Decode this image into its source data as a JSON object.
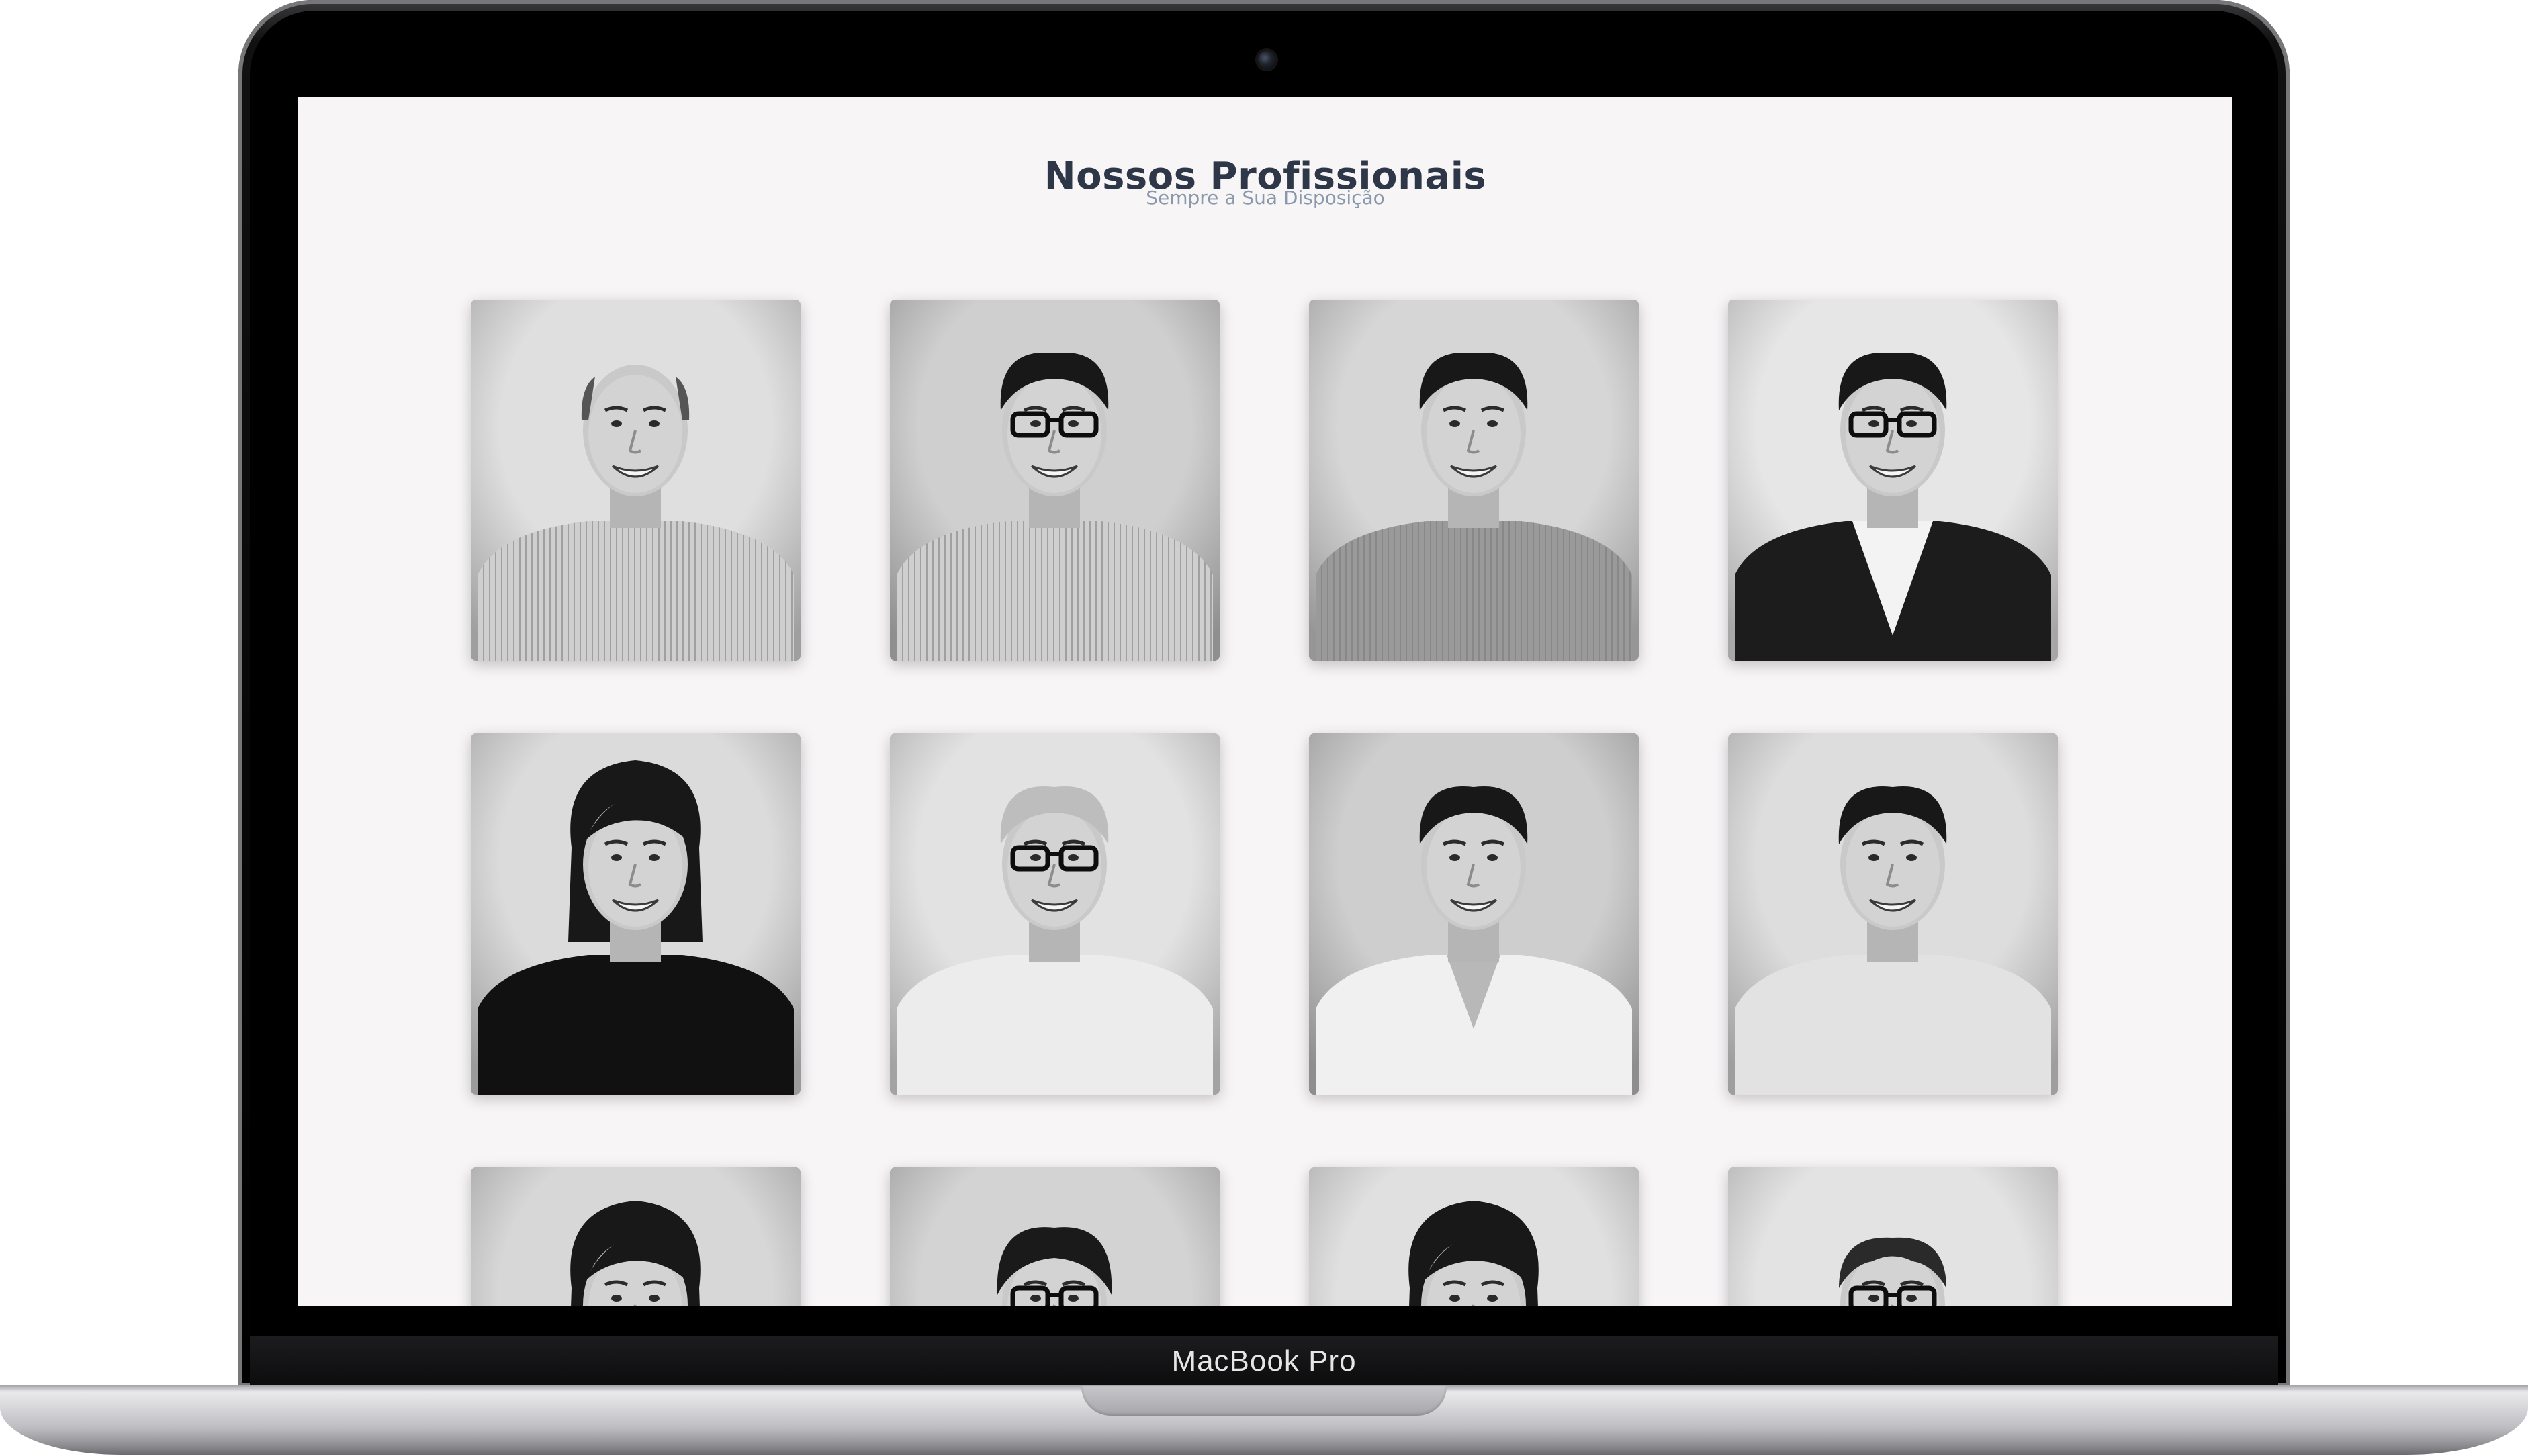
{
  "device": {
    "model_label": "MacBook Pro"
  },
  "page": {
    "title": "Nossos Profissionais",
    "subtitle": "Sempre a Sua Disposição"
  },
  "professionals": [
    {
      "portrait": "man-smiling-striped-shirt",
      "bg": "#d4d4d4",
      "top": "stripes-light",
      "hair": "bald",
      "glasses": false
    },
    {
      "portrait": "man-glasses-dark-hair",
      "bg": "#bfbfbf",
      "top": "stripes-light",
      "hair": "dark",
      "glasses": true
    },
    {
      "portrait": "man-dark-hair-striped-shirt",
      "bg": "#c8c8c8",
      "top": "stripes-dark",
      "hair": "dark",
      "glasses": false
    },
    {
      "portrait": "man-glasses-dark-suit",
      "bg": "#dedede",
      "top": "suit",
      "hair": "dark",
      "glasses": true
    },
    {
      "portrait": "woman-dark-top",
      "bg": "#cfcfcf",
      "top": "black",
      "hair": "bob",
      "glasses": false
    },
    {
      "portrait": "older-man-glasses",
      "bg": "#d9d9d9",
      "top": "white",
      "hair": "grey",
      "glasses": true
    },
    {
      "portrait": "man-lab-coat",
      "bg": "#bdbdbd",
      "top": "labcoat",
      "hair": "dark",
      "glasses": false
    },
    {
      "portrait": "man-light-shirt-arms-crossed",
      "bg": "#d2d2d2",
      "top": "light",
      "hair": "dark",
      "glasses": false
    },
    {
      "portrait": "woman-long-dark-hair",
      "bg": "#cacaca",
      "top": "none",
      "hair": "long",
      "glasses": false
    },
    {
      "portrait": "woman-glasses-short-hair",
      "bg": "#c4c4c4",
      "top": "none",
      "hair": "short",
      "glasses": true
    },
    {
      "portrait": "woman-dark-hair",
      "bg": "#d6d6d6",
      "top": "none",
      "hair": "long",
      "glasses": false
    },
    {
      "portrait": "man-glasses-receding-hair",
      "bg": "#dadada",
      "top": "none",
      "hair": "receding",
      "glasses": true
    }
  ]
}
